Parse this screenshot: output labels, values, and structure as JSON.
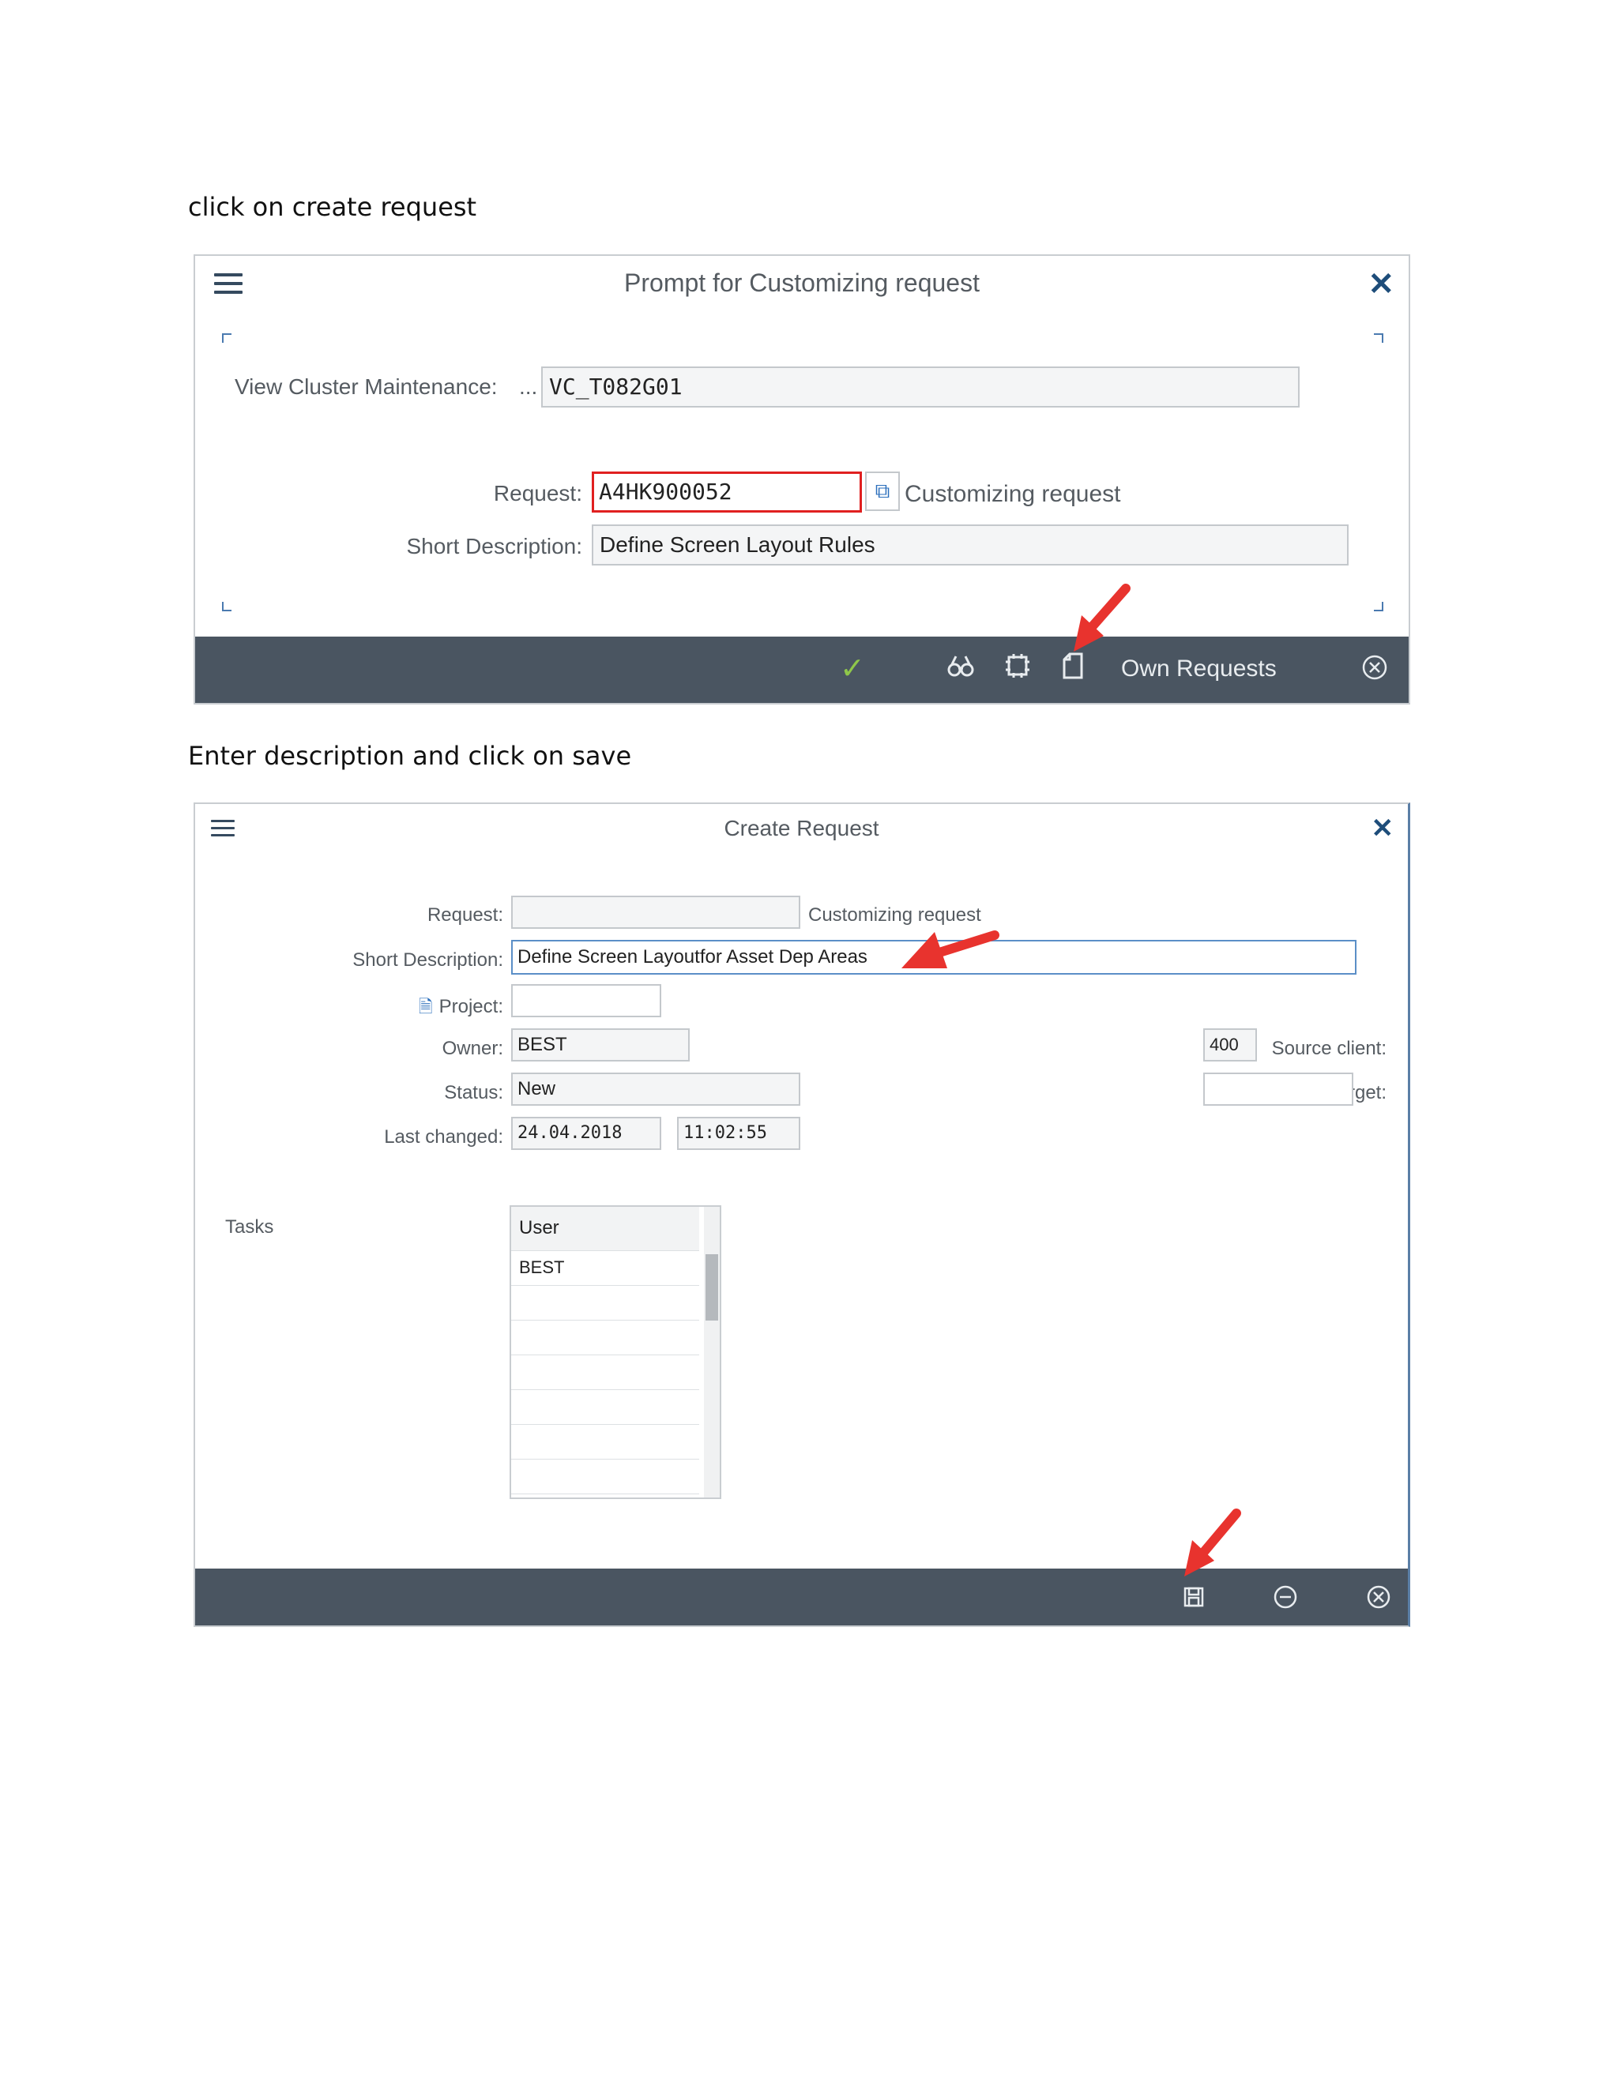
{
  "instructions": {
    "step1": "click on create request",
    "step2": "Enter description and click on save"
  },
  "dialog1": {
    "title": "Prompt for Customizing request",
    "view_cluster_label": "View Cluster Maintenance:",
    "view_cluster_ellipsis": "...",
    "view_cluster_value": "VC_T082G01",
    "request_label": "Request:",
    "request_value": "A4HK900052",
    "request_type": "Customizing request",
    "short_desc_label": "Short Description:",
    "short_desc_value": "Define Screen Layout Rules",
    "footer": {
      "own_requests_label": "Own Requests",
      "icons": [
        "checkmark-icon",
        "binoculars-icon",
        "settings-icon",
        "create-document-icon",
        "cancel-icon"
      ]
    }
  },
  "dialog2": {
    "title": "Create Request",
    "request_label": "Request:",
    "request_value": "",
    "request_type": "Customizing request",
    "short_desc_label": "Short Description:",
    "short_desc_value": "Define Screen Layoutfor Asset Dep Areas",
    "project_label": "Project:",
    "project_value": "",
    "owner_label": "Owner:",
    "owner_value": "BEST",
    "status_label": "Status:",
    "status_value": "New",
    "last_changed_label": "Last changed:",
    "last_changed_date": "24.04.2018",
    "last_changed_time": "11:02:55",
    "source_client_label": "Source client:",
    "source_client_value": "400",
    "target_label": "Target:",
    "target_value": "",
    "tasks_label": "Tasks",
    "tasks_table": {
      "header": "User",
      "rows": [
        "BEST",
        "",
        "",
        "",
        "",
        "",
        ""
      ]
    },
    "footer": {
      "icons": [
        "save-icon",
        "minus-icon",
        "cancel-icon"
      ]
    }
  },
  "colors": {
    "footer_bg": "#4a5561",
    "highlight_red": "#e02020",
    "arrow_red": "#e8332e",
    "accent_blue": "#1e4d7a",
    "check_green": "#8fc74a"
  }
}
